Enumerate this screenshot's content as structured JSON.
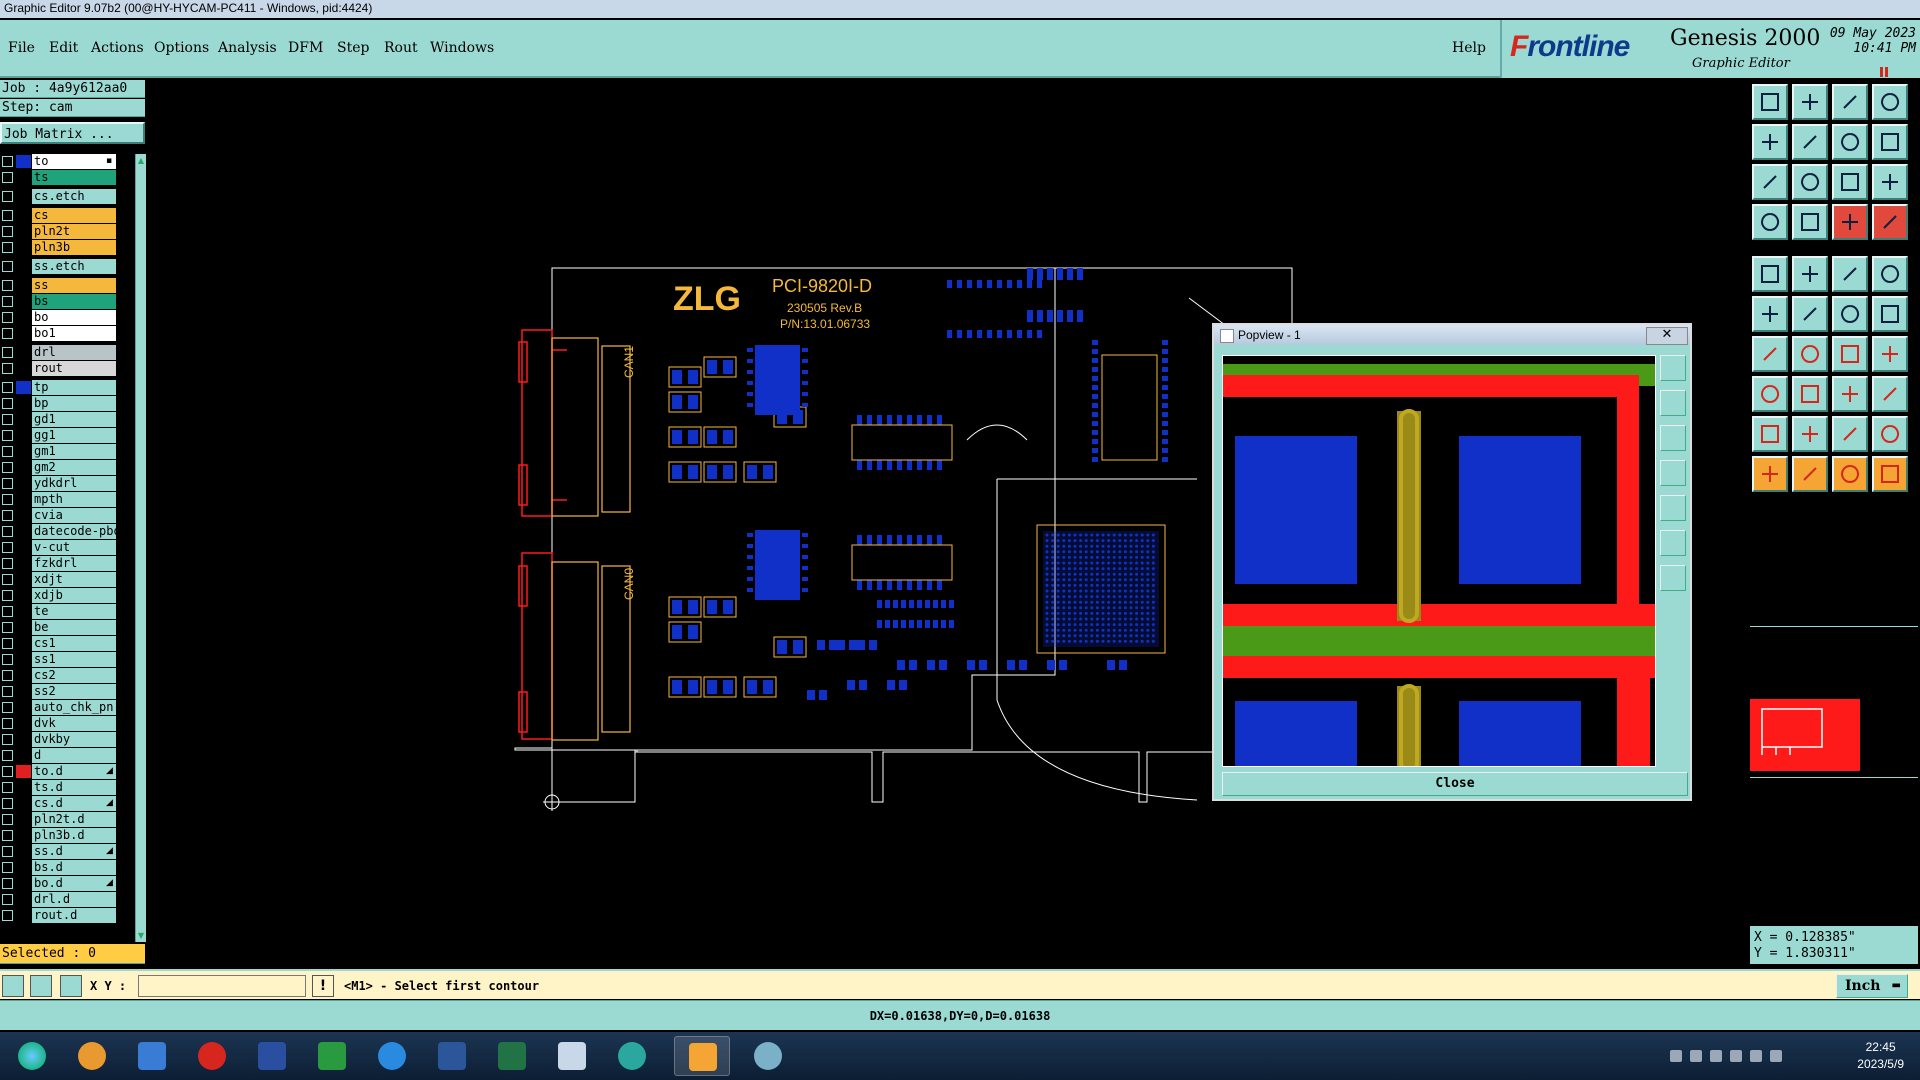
{
  "window": {
    "title": "Graphic Editor 9.07b2 (00@HY-HYCAM-PC411 - Windows, pid:4424)"
  },
  "menu": {
    "items": [
      "File",
      "Edit",
      "Actions",
      "Options",
      "Analysis",
      "DFM",
      "Step",
      "Rout",
      "Windows"
    ],
    "help": "Help"
  },
  "brand": {
    "logo_f": "F",
    "logo_rest": "rontline",
    "product": "Genesis 2000",
    "subtitle": "Graphic Editor",
    "date": "09 May 2023",
    "time": "10:41 PM"
  },
  "panel": {
    "job": "Job : 4a9y612aa0",
    "step": "Step: cam",
    "job_matrix": "Job Matrix ...",
    "selected": "Selected : 0"
  },
  "layers": [
    {
      "name": "to",
      "color": "#ffffff",
      "swatch": "#1030c8",
      "mark": "▪"
    },
    {
      "name": "ts",
      "color": "#1fa37a",
      "swatch": "",
      "mark": ""
    },
    {
      "name": "cs.etch",
      "color": "#9bdad2",
      "swatch": "",
      "mark": ""
    },
    {
      "name": "cs",
      "color": "#f4b93c",
      "swatch": "",
      "mark": ""
    },
    {
      "name": "pln2t",
      "color": "#f4b93c",
      "swatch": "",
      "mark": ""
    },
    {
      "name": "pln3b",
      "color": "#f4b93c",
      "swatch": "",
      "mark": ""
    },
    {
      "name": "ss.etch",
      "color": "#9bdad2",
      "swatch": "",
      "mark": ""
    },
    {
      "name": "ss",
      "color": "#f4b93c",
      "swatch": "",
      "mark": ""
    },
    {
      "name": "bs",
      "color": "#1fa37a",
      "swatch": "",
      "mark": ""
    },
    {
      "name": "bo",
      "color": "#ffffff",
      "swatch": "",
      "mark": ""
    },
    {
      "name": "bo1",
      "color": "#ffffff",
      "swatch": "",
      "mark": ""
    },
    {
      "name": "drl",
      "color": "#b8c4c8",
      "swatch": "",
      "mark": ""
    },
    {
      "name": "rout",
      "color": "#d8d8d8",
      "swatch": "",
      "mark": ""
    },
    {
      "name": "tp",
      "color": "#9bdad2",
      "swatch": "#1030c8",
      "mark": ""
    },
    {
      "name": "bp",
      "color": "#9bdad2",
      "swatch": "",
      "mark": ""
    },
    {
      "name": "gd1",
      "color": "#9bdad2",
      "swatch": "",
      "mark": ""
    },
    {
      "name": "gg1",
      "color": "#9bdad2",
      "swatch": "",
      "mark": ""
    },
    {
      "name": "gm1",
      "color": "#9bdad2",
      "swatch": "",
      "mark": ""
    },
    {
      "name": "gm2",
      "color": "#9bdad2",
      "swatch": "",
      "mark": ""
    },
    {
      "name": "ydkdrl",
      "color": "#9bdad2",
      "swatch": "",
      "mark": ""
    },
    {
      "name": "mpth",
      "color": "#9bdad2",
      "swatch": "",
      "mark": ""
    },
    {
      "name": "cvia",
      "color": "#9bdad2",
      "swatch": "",
      "mark": ""
    },
    {
      "name": "datecode-pbo",
      "color": "#9bdad2",
      "swatch": "",
      "mark": ""
    },
    {
      "name": "v-cut",
      "color": "#9bdad2",
      "swatch": "",
      "mark": ""
    },
    {
      "name": "fzkdrl",
      "color": "#9bdad2",
      "swatch": "",
      "mark": ""
    },
    {
      "name": "xdjt",
      "color": "#9bdad2",
      "swatch": "",
      "mark": ""
    },
    {
      "name": "xdjb",
      "color": "#9bdad2",
      "swatch": "",
      "mark": ""
    },
    {
      "name": "te",
      "color": "#9bdad2",
      "swatch": "",
      "mark": ""
    },
    {
      "name": "be",
      "color": "#9bdad2",
      "swatch": "",
      "mark": ""
    },
    {
      "name": "cs1",
      "color": "#9bdad2",
      "swatch": "",
      "mark": ""
    },
    {
      "name": "ss1",
      "color": "#9bdad2",
      "swatch": "",
      "mark": ""
    },
    {
      "name": "cs2",
      "color": "#9bdad2",
      "swatch": "",
      "mark": ""
    },
    {
      "name": "ss2",
      "color": "#9bdad2",
      "swatch": "",
      "mark": ""
    },
    {
      "name": "auto_chk_pn",
      "color": "#9bdad2",
      "swatch": "",
      "mark": ""
    },
    {
      "name": "dvk",
      "color": "#9bdad2",
      "swatch": "",
      "mark": ""
    },
    {
      "name": "dvkby",
      "color": "#9bdad2",
      "swatch": "",
      "mark": ""
    },
    {
      "name": "d",
      "color": "#9bdad2",
      "swatch": "",
      "mark": ""
    },
    {
      "name": "to.d",
      "color": "#9bdad2",
      "swatch": "#e02020",
      "mark": "◢"
    },
    {
      "name": "ts.d",
      "color": "#9bdad2",
      "swatch": "",
      "mark": ""
    },
    {
      "name": "cs.d",
      "color": "#9bdad2",
      "swatch": "",
      "mark": "◢"
    },
    {
      "name": "pln2t.d",
      "color": "#9bdad2",
      "swatch": "",
      "mark": ""
    },
    {
      "name": "pln3b.d",
      "color": "#9bdad2",
      "swatch": "",
      "mark": ""
    },
    {
      "name": "ss.d",
      "color": "#9bdad2",
      "swatch": "",
      "mark": "◢"
    },
    {
      "name": "bs.d",
      "color": "#9bdad2",
      "swatch": "",
      "mark": ""
    },
    {
      "name": "bo.d",
      "color": "#9bdad2",
      "swatch": "",
      "mark": "◢"
    },
    {
      "name": "drl.d",
      "color": "#9bdad2",
      "swatch": "",
      "mark": ""
    },
    {
      "name": "rout.d",
      "color": "#9bdad2",
      "swatch": "",
      "mark": ""
    }
  ],
  "board": {
    "brand": "ZLG",
    "model": "PCI-9820I-D",
    "revision": "230505 Rev.B",
    "part_number": "P/N:13.01.06733",
    "connector_1": "CAN1",
    "connector_0": "CAN0"
  },
  "popview": {
    "title": "Popview - 1",
    "close_label": "Close"
  },
  "coords": {
    "x": "X = 0.128385\"",
    "y": "Y = 1.830311\""
  },
  "command": {
    "xy_label": "X Y :",
    "xy_value": "",
    "prompt": "<M1> - Select first contour",
    "units": "Inch"
  },
  "status": {
    "text": "DX=0.01638,DY=0,D=0.01638"
  },
  "taskbar": {
    "time": "22:45",
    "date": "2023/5/9"
  },
  "colors": {
    "ui": "#9bdad2",
    "silkscreen": "#f4b93c",
    "pad": "#1030c8",
    "copper": "#ff1a1a",
    "mask": "#4a9a18"
  }
}
